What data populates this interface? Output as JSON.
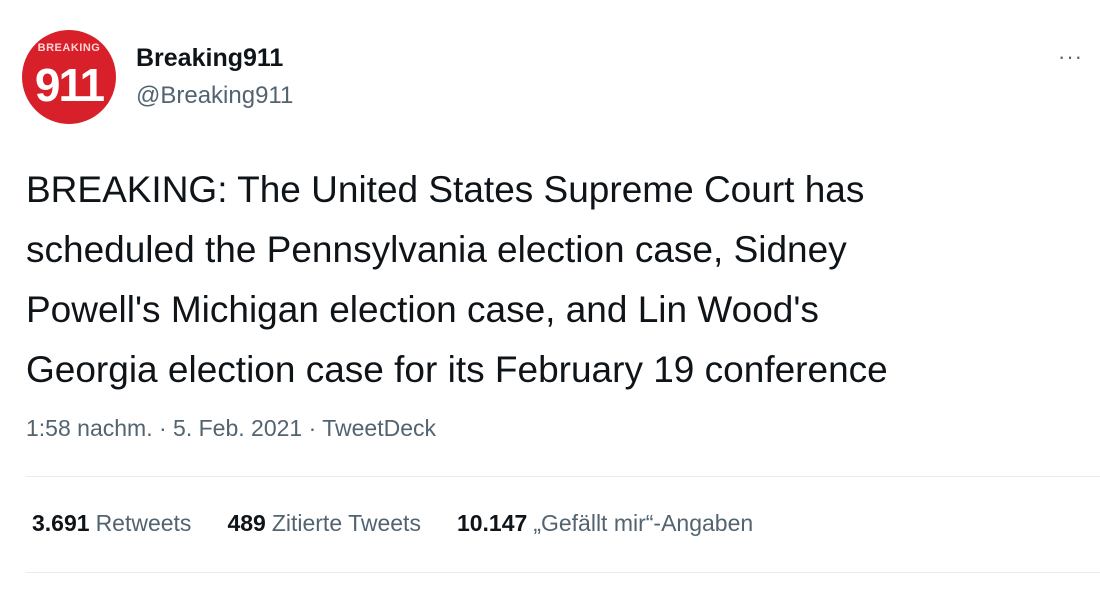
{
  "author": {
    "avatar_ribbon": "BREAKING",
    "avatar_number": "911",
    "display_name": "Breaking911",
    "handle": "@Breaking911"
  },
  "more_glyph": "···",
  "tweet": {
    "text": "BREAKING: The United States Supreme Court has\nscheduled the Pennsylvania election case, Sidney\nPowell's Michigan election case, and Lin Wood's\nGeorgia election case for its February 19 conference"
  },
  "meta": {
    "time": "1:58 nachm.",
    "sep1": " · ",
    "date": "5. Feb. 2021",
    "sep2": " · ",
    "source": "TweetDeck"
  },
  "stats": [
    {
      "count": "3.691",
      "label": "Retweets"
    },
    {
      "count": "489",
      "label": "Zitierte Tweets"
    },
    {
      "count": "10.147",
      "label": "„Gefällt mir“-Angaben"
    }
  ],
  "colors": {
    "avatar_bg": "#d8202a",
    "text_primary": "#0f1419",
    "text_secondary": "#536471"
  }
}
